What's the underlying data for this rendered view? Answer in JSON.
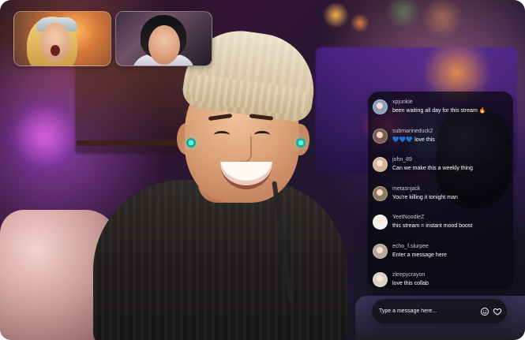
{
  "participants": [
    {
      "id": "participant-1"
    },
    {
      "id": "participant-2"
    }
  ],
  "chat": {
    "messages": [
      {
        "user": "xpjunkie",
        "text": "been waiting all day for this stream 🔥",
        "avatar_color": "#8ca0b8",
        "avatar_icon": "person-avatar"
      },
      {
        "user": "submarineduck2",
        "text": "💙💙💙 love this",
        "avatar_color": "#7c5b54",
        "avatar_icon": "person-avatar"
      },
      {
        "user": "john_89",
        "text": "Can we make this a weekly thing",
        "avatar_color": "#d4b398",
        "avatar_icon": "person-avatar"
      },
      {
        "user": "metasnjack",
        "text": "You're killing it tonight man",
        "avatar_color": "#8e7a61",
        "avatar_icon": "person-avatar"
      },
      {
        "user": "YeetNoodleZ",
        "text": "this stream = instant mood boost",
        "avatar_color": "#f2f2f2",
        "avatar_icon": "dog-avatar"
      },
      {
        "user": "echo_f.slurpee",
        "text": "Enter a message here",
        "avatar_color": "#b6a59d",
        "avatar_icon": "person-avatar"
      },
      {
        "user": "zleepycrayon",
        "text": "love this collab",
        "avatar_color": "#d5d3c6",
        "avatar_icon": "person-avatar"
      }
    ],
    "composer": {
      "placeholder": "Type a message here...",
      "emoji_icon": "emoji-icon",
      "heart_icon": "heart-icon"
    }
  }
}
